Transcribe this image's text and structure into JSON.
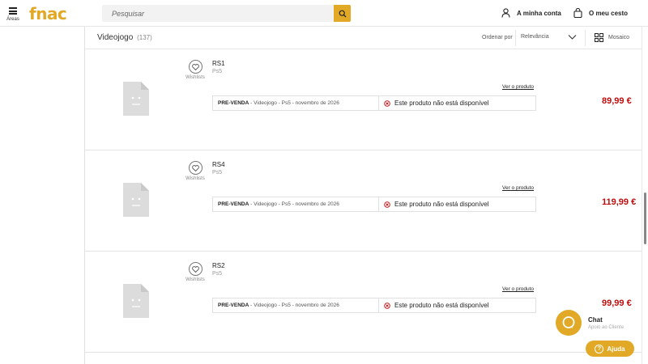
{
  "header": {
    "menu_label": "Áreas",
    "logo": "fnac",
    "search_placeholder": "Pesquisar",
    "account_label": "A minha conta",
    "cart_label": "O meu cesto"
  },
  "toolbar": {
    "title": "Videojogo",
    "count": "(137)",
    "sort_label": "Ordenar por",
    "sort_value": "Relevância",
    "view_label": "Mosaico"
  },
  "products": [
    {
      "name": "RS1",
      "platform": "Ps5",
      "wishlist_label": "Wishlists",
      "link_label": "Ver o produto",
      "type_label": "PRE-VENDA",
      "details": " - Videojogo - Ps5 - novembro de 2026",
      "status": "Este produto não está disponível",
      "price": "89,99 €"
    },
    {
      "name": "RS4",
      "platform": "Ps5",
      "wishlist_label": "Wishlists",
      "link_label": "Ver o produto",
      "type_label": "PRE-VENDA",
      "details": " - Videojogo - Ps5 - novembro de 2026",
      "status": "Este produto não está disponível",
      "price": "119,99 €"
    },
    {
      "name": "RS2",
      "platform": "Ps5",
      "wishlist_label": "Wishlists",
      "link_label": "Ver o produto",
      "type_label": "PRE-VENDA",
      "details": " - Videojogo - Ps5 - novembro de 2026",
      "status": "Este produto não está disponível",
      "price": "99,99 €"
    }
  ],
  "chat": {
    "title": "Chat",
    "subtitle": "Apoio ao Cliente"
  },
  "help": {
    "label": "Ajuda"
  },
  "colors": {
    "brand": "#e1a925",
    "price": "#c00d0d"
  }
}
